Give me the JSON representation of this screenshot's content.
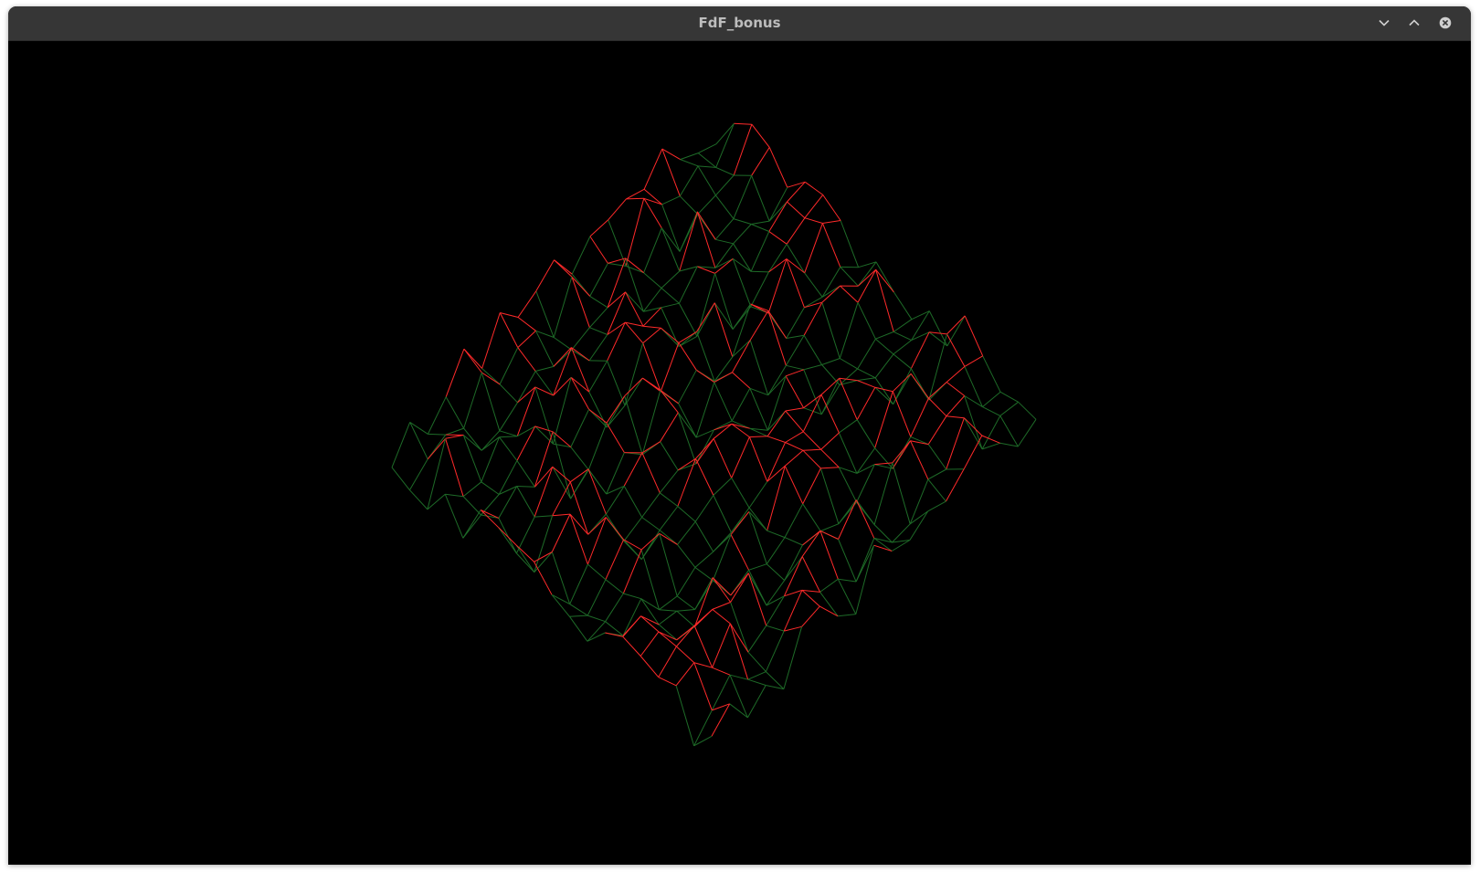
{
  "window": {
    "title": "FdF_bonus"
  },
  "titlebar_controls": [
    {
      "name": "minimize-button",
      "icon": "chevron-down-icon"
    },
    {
      "name": "maximize-button",
      "icon": "chevron-up-icon"
    },
    {
      "name": "close-button",
      "icon": "close-icon"
    }
  ],
  "render": {
    "type": "wireframe-heightmap",
    "projection": "isometric",
    "background": "#000000",
    "colors": {
      "low": "#1e6b28",
      "high": "#ff2a2a"
    }
  }
}
